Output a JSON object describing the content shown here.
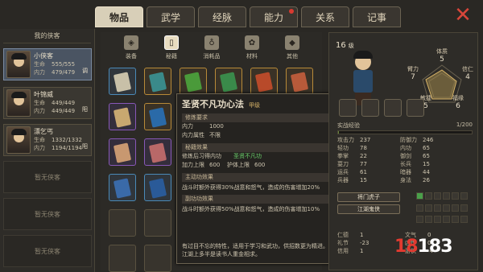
{
  "tabs": [
    {
      "label": "物品",
      "active": true
    },
    {
      "label": "武学",
      "active": false
    },
    {
      "label": "经脉",
      "active": false
    },
    {
      "label": "能力",
      "active": false,
      "badge": true
    },
    {
      "label": "关系",
      "active": false
    },
    {
      "label": "记事",
      "active": false
    }
  ],
  "left": {
    "title": "我的侠客",
    "heroes": [
      {
        "name": "小侠客",
        "hp_label": "生命",
        "hp": "555/555",
        "mp_label": "内力",
        "mp": "479/479",
        "tag": "调"
      },
      {
        "name": "叶锦威",
        "hp_label": "生命",
        "hp": "449/449",
        "mp_label": "内力",
        "mp": "449/449",
        "tag": "阳"
      },
      {
        "name": "漂乞丐",
        "hp_label": "生命",
        "hp": "1332/1332",
        "mp_label": "内力",
        "mp": "1194/1194",
        "tag": "阳"
      }
    ],
    "empty_label": "暂无侠客"
  },
  "subtabs": [
    {
      "label": "装备",
      "icon": "armor-icon"
    },
    {
      "label": "秘籍",
      "icon": "book-icon",
      "active": true
    },
    {
      "label": "消耗品",
      "icon": "potion-icon"
    },
    {
      "label": "材料",
      "icon": "herb-icon"
    },
    {
      "label": "其他",
      "icon": "bag-icon"
    }
  ],
  "tooltip": {
    "title": "圣贤不凡功心法",
    "grade": "甲级",
    "sec_req": "修炼要求",
    "req": [
      {
        "k": "内力",
        "v": "1000"
      },
      {
        "k": "内力属性",
        "v": "不限"
      }
    ],
    "sec_effect": "秘籍效果",
    "effect_line": {
      "k": "修炼后习得内功",
      "v": "圣贤不凡功"
    },
    "effect_stats": [
      {
        "k": "加力上限",
        "v": "600"
      },
      {
        "k": "护体上限",
        "v": "600"
      }
    ],
    "sec_main": "主动功效果",
    "main_desc": "战斗时额外获得30%战意和怒气，造成的伤害增加20%",
    "sec_sub": "副功功效果",
    "sub_desc": "战斗时额外获得50%战意和怒气，造成的伤害增加10%",
    "footer": "有过目不忘的特性，适用于学习和武功，供招数更为精进。江湖上多半是读书人重金相求。"
  },
  "right": {
    "level": "16",
    "level_unit": "级",
    "radar": [
      {
        "k": "体质",
        "v": "5"
      },
      {
        "k": "信仁",
        "v": "4"
      },
      {
        "k": "福缘",
        "v": "6"
      },
      {
        "k": "敏捷",
        "v": "5"
      },
      {
        "k": "臂力",
        "v": "7"
      }
    ],
    "exp_label": "实战经验",
    "exp_value": "1/200",
    "exp_fraction": 0.005,
    "stats": [
      [
        {
          "k": "攻击力",
          "v": "237"
        },
        {
          "k": "防御力",
          "v": "246"
        }
      ],
      [
        {
          "k": "轻功",
          "v": "78"
        },
        {
          "k": "内功",
          "v": "65"
        }
      ],
      [
        {
          "k": "拳掌",
          "v": "22"
        },
        {
          "k": "御剑",
          "v": "65"
        }
      ],
      [
        {
          "k": "耍刀",
          "v": "77"
        },
        {
          "k": "长兵",
          "v": "15"
        }
      ],
      [
        {
          "k": "运兵",
          "v": "61"
        },
        {
          "k": "暗器",
          "v": "44"
        }
      ],
      [
        {
          "k": "兵器",
          "v": "15"
        },
        {
          "k": "身法",
          "v": "26"
        }
      ]
    ],
    "btn1": "将门虎子",
    "btn2": "江湖鬼侠",
    "virtue": [
      [
        {
          "k": "仁德",
          "v": "1"
        },
        {
          "k": "文气",
          "v": "0"
        }
      ],
      [
        {
          "k": "礼节",
          "v": "-23"
        },
        {
          "k": "凶悍",
          "v": "0"
        }
      ],
      [
        {
          "k": "信用",
          "v": "1"
        },
        {
          "k": "游侠",
          "v": "-4"
        }
      ]
    ]
  },
  "watermark": {
    "a": "18",
    "b": "183"
  }
}
